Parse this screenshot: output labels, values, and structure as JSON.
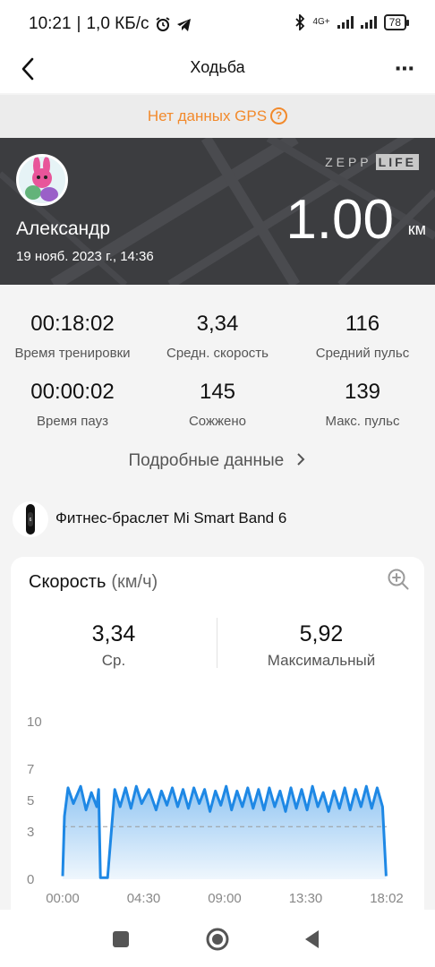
{
  "status": {
    "time": "10:21",
    "speed": "1,0 КБ/с",
    "network": "4G+",
    "battery": "78"
  },
  "header": {
    "title": "Ходьба"
  },
  "gps": {
    "text": "Нет данных GPS"
  },
  "banner": {
    "brand": "ZEPP",
    "brand_badge": "LIFE",
    "user_name": "Александр",
    "date": "19 нояб. 2023 г., 14:36",
    "distance": "1.00",
    "distance_unit": "км"
  },
  "stats": [
    {
      "value": "00:18:02",
      "label": "Время тренировки"
    },
    {
      "value": "3,34",
      "label": "Средн. скорость"
    },
    {
      "value": "116",
      "label": "Средний пульс"
    },
    {
      "value": "00:00:02",
      "label": "Время пауз"
    },
    {
      "value": "145",
      "label": "Сожжено"
    },
    {
      "value": "139",
      "label": "Макс. пульс"
    }
  ],
  "details_link": "Подробные данные",
  "device": {
    "name": "Фитнес-браслет Mi Smart Band 6"
  },
  "speed_card": {
    "title": "Скорость",
    "unit": "(км/ч)",
    "avg_value": "3,34",
    "avg_label": "Ср.",
    "max_value": "5,92",
    "max_label": "Максимальный"
  },
  "chart_data": {
    "type": "area",
    "y_ticks": [
      "0",
      "3",
      "5",
      "7",
      "10"
    ],
    "x_ticks": [
      "00:00",
      "04:30",
      "09:00",
      "13:30",
      "18:02"
    ],
    "ylim": [
      0,
      10
    ],
    "xlim": [
      0,
      18.03
    ],
    "average": 3.34,
    "line_color": "#1e88e5",
    "x": [
      0.0,
      0.1,
      0.3,
      0.6,
      1.0,
      1.3,
      1.6,
      1.9,
      2.0,
      2.1,
      2.5,
      2.9,
      3.2,
      3.5,
      3.8,
      4.1,
      4.4,
      4.8,
      5.2,
      5.5,
      5.8,
      6.1,
      6.4,
      6.7,
      7.0,
      7.3,
      7.6,
      7.9,
      8.2,
      8.5,
      8.8,
      9.1,
      9.4,
      9.7,
      10.0,
      10.3,
      10.6,
      10.9,
      11.2,
      11.5,
      11.8,
      12.1,
      12.4,
      12.7,
      13.0,
      13.3,
      13.6,
      13.9,
      14.2,
      14.5,
      14.8,
      15.1,
      15.4,
      15.7,
      16.0,
      16.3,
      16.6,
      16.9,
      17.2,
      17.5,
      17.8,
      18.0
    ],
    "y": [
      0.2,
      4.0,
      5.8,
      4.8,
      5.9,
      4.4,
      5.5,
      4.6,
      5.7,
      0.1,
      0.1,
      5.7,
      4.6,
      5.8,
      4.5,
      5.9,
      4.8,
      5.7,
      4.4,
      5.6,
      4.7,
      5.8,
      4.6,
      5.7,
      4.5,
      5.8,
      4.8,
      5.7,
      4.3,
      5.6,
      4.7,
      5.9,
      4.4,
      5.6,
      4.6,
      5.8,
      4.5,
      5.7,
      4.4,
      5.8,
      4.6,
      5.6,
      4.3,
      5.8,
      4.5,
      5.7,
      4.4,
      5.9,
      4.6,
      5.5,
      4.3,
      5.6,
      4.5,
      5.8,
      4.4,
      5.7,
      4.6,
      5.9,
      4.5,
      5.8,
      4.6,
      0.2
    ]
  }
}
